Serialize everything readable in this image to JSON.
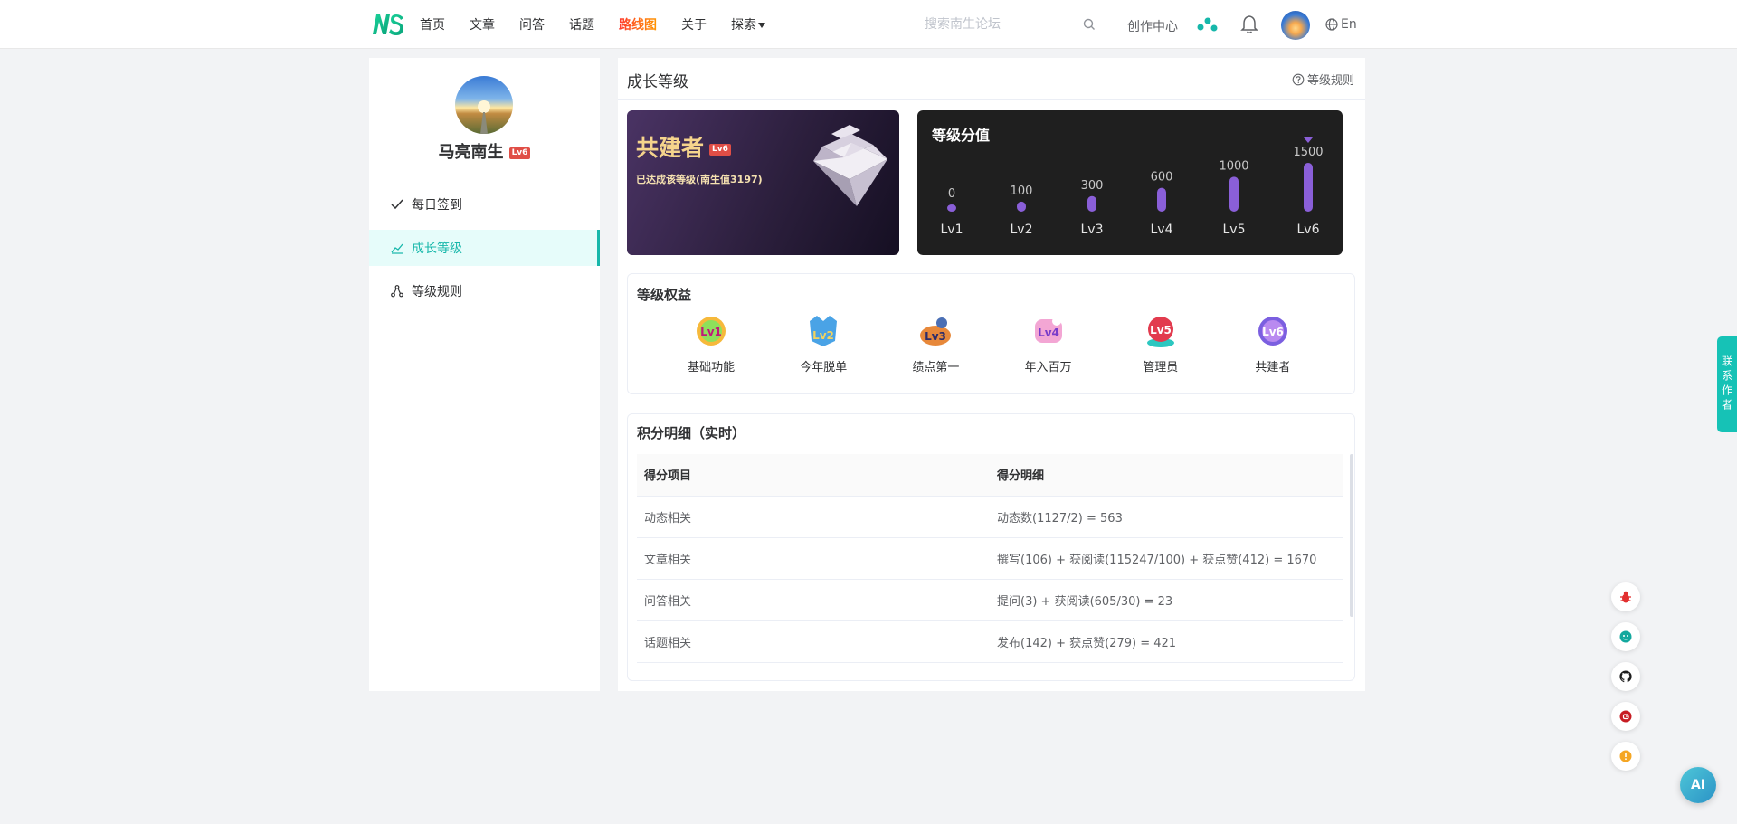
{
  "header": {
    "nav": [
      {
        "label": "首页"
      },
      {
        "label": "文章"
      },
      {
        "label": "问答"
      },
      {
        "label": "话题"
      },
      {
        "label": "路线图"
      },
      {
        "label": "关于"
      },
      {
        "label": "探索"
      }
    ],
    "search_placeholder": "搜索南生论坛",
    "creator_label": "创作中心",
    "lang_label": "En"
  },
  "sidebar": {
    "name": "马亮南生",
    "badge": "Lv6",
    "menu": [
      {
        "label": "每日签到",
        "icon": "check-icon"
      },
      {
        "label": "成长等级",
        "icon": "trend-icon",
        "active": true
      },
      {
        "label": "等级规则",
        "icon": "network-icon"
      }
    ]
  },
  "main": {
    "title": "成长等级",
    "rules_link": "等级规则",
    "level_card": {
      "name": "共建者",
      "badge": "Lv6",
      "desc": "已达成该等级(南生值3197)"
    },
    "score_card": {
      "title": "等级分值",
      "levels": [
        {
          "label": "Lv1",
          "value": 0
        },
        {
          "label": "Lv2",
          "value": 100
        },
        {
          "label": "Lv3",
          "value": 300
        },
        {
          "label": "Lv4",
          "value": 600
        },
        {
          "label": "Lv5",
          "value": 1000
        },
        {
          "label": "Lv6",
          "value": 1500
        }
      ],
      "current_label": "Lv6"
    },
    "rights": {
      "title": "等级权益",
      "items": [
        {
          "label": "基础功能",
          "icon": "lv1-badge-icon"
        },
        {
          "label": "今年脱单",
          "icon": "lv2-badge-icon"
        },
        {
          "label": "绩点第一",
          "icon": "lv3-badge-icon"
        },
        {
          "label": "年入百万",
          "icon": "lv4-badge-icon"
        },
        {
          "label": "管理员",
          "icon": "lv5-badge-icon"
        },
        {
          "label": "共建者",
          "icon": "lv6-badge-icon"
        }
      ]
    },
    "detail": {
      "title": "积分明细（实时）",
      "columns": [
        "得分项目",
        "得分明细"
      ],
      "rows": [
        [
          "动态相关",
          "动态数(1127/2) = 563"
        ],
        [
          "文章相关",
          "撰写(106) + 获阅读(115247/100) + 获点赞(412) = 1670"
        ],
        [
          "问答相关",
          "提问(3) + 获阅读(605/30) = 23"
        ],
        [
          "话题相关",
          "发布(142) + 获点赞(279) = 421"
        ]
      ]
    }
  },
  "floating": {
    "contact_label": "联系作者",
    "ai_label": "AI"
  },
  "colors": {
    "accent": "#16b7aa",
    "bar": "#8a5fd8",
    "badge": "#e04e46"
  }
}
